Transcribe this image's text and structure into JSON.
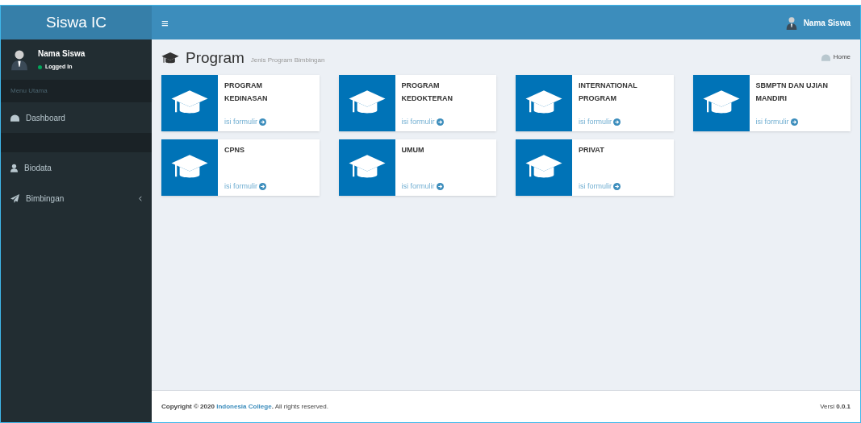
{
  "brand": "Siswa IC",
  "navbar": {
    "menu_toggle": "≡",
    "user_name": "Nama Siswa"
  },
  "sidebar": {
    "user": {
      "name": "Nama Siswa",
      "status": "Logged In",
      "online": true
    },
    "items": [
      {
        "kind": "header",
        "label": "Menu Utama"
      },
      {
        "kind": "link",
        "label": "Dashboard",
        "expandable": false
      },
      {
        "kind": "spacer"
      },
      {
        "kind": "link",
        "label": "Biodata",
        "expandable": false
      },
      {
        "kind": "link",
        "label": "Bimbingan",
        "expandable": true
      }
    ]
  },
  "page": {
    "title": "Program",
    "subtitle": "Jenis Program Bimbingan",
    "breadcrumb": "Home"
  },
  "programs": [
    {
      "title": "PROGRAM KEDINASAN",
      "link": "isi formulir"
    },
    {
      "title": "PROGRAM KEDOKTERAN",
      "link": "isi formulir"
    },
    {
      "title": "INTERNATIONAL PROGRAM",
      "link": "isi formulir"
    },
    {
      "title": "SBMPTN DAN UJIAN MANDIRI",
      "link": "isi formulir"
    },
    {
      "title": "CPNS",
      "link": "isi formulir"
    },
    {
      "title": "UMUM",
      "link": "isi formulir"
    },
    {
      "title": "PRIVAT",
      "link": "isi formulir"
    }
  ],
  "footer": {
    "copyright": "Copyright © 2020",
    "link": "Indonesia College",
    "rest": "**.** All rights reserved.",
    "version_label": "Versi",
    "version": "0.0.1"
  }
}
